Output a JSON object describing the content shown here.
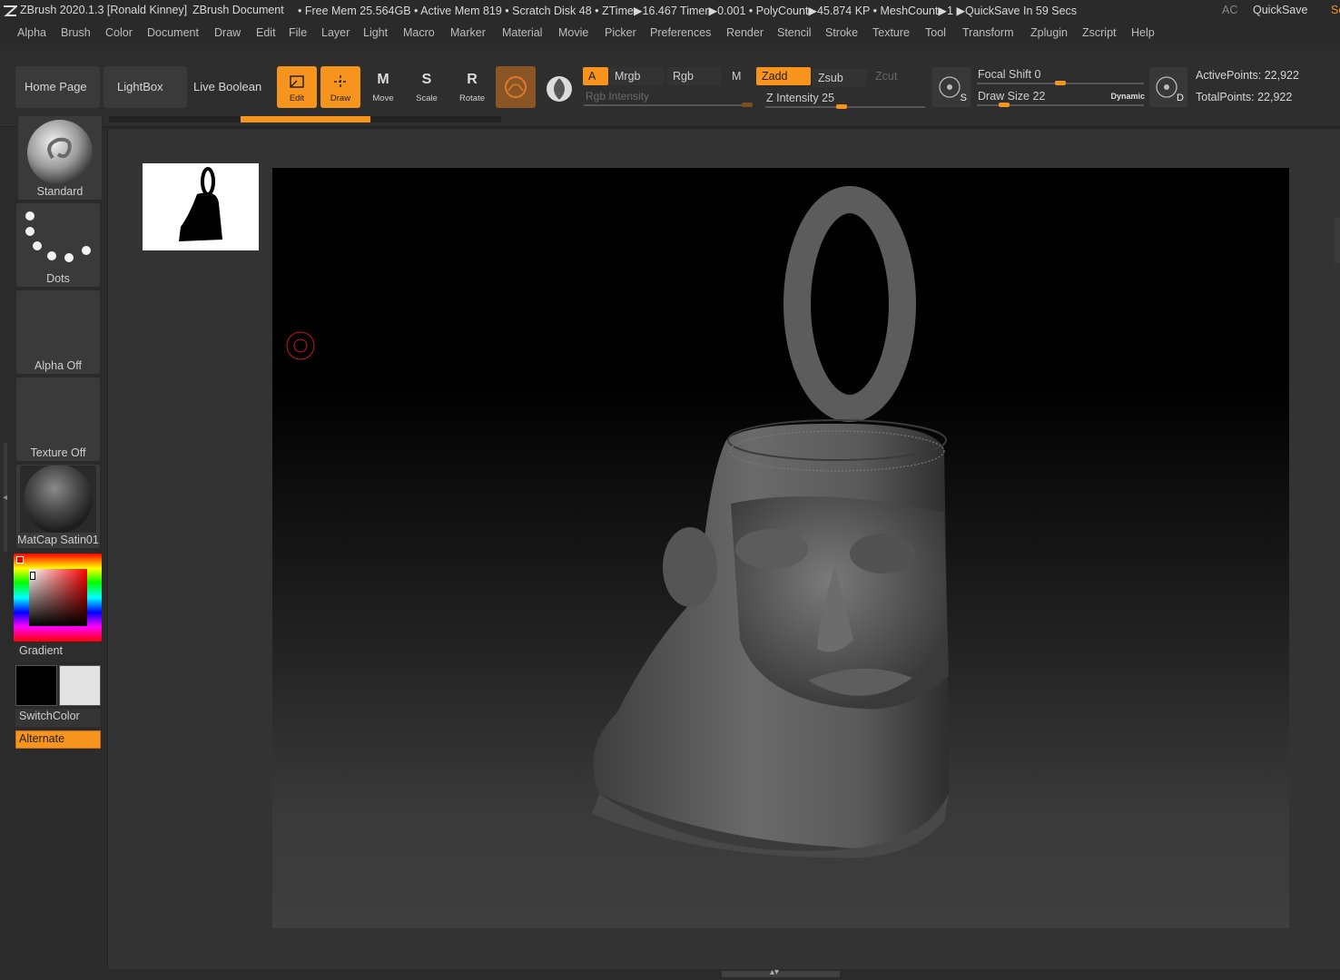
{
  "titlebar": {
    "app": "ZBrush 2020.1.3 [Ronald Kinney]",
    "doc": "ZBrush Document",
    "stats": "• Free Mem 25.564GB • Active Mem 819 • Scratch Disk 48 •  ZTime▶16.467 Timer▶0.001 • PolyCount▶45.874 KP  • MeshCount▶1  ▶QuickSave In 59 Secs",
    "ac": "AC",
    "quicksave": "QuickSave",
    "se": "Se"
  },
  "menus": [
    "Alpha",
    "Brush",
    "Color",
    "Document",
    "Draw",
    "Edit",
    "File",
    "Layer",
    "Light",
    "Macro",
    "Marker",
    "Material",
    "Movie",
    "Picker",
    "Preferences",
    "Render",
    "Stencil",
    "Stroke",
    "Texture",
    "Tool",
    "Transform",
    "Zplugin",
    "Zscript",
    "Help"
  ],
  "shelf": {
    "home": "Home Page",
    "lightbox": "LightBox",
    "liveboolean": "Live Boolean",
    "tools": {
      "edit": "Edit",
      "draw": "Draw",
      "move": "Move",
      "scale": "Scale",
      "rotate": "Rotate"
    },
    "tool_glyphs": {
      "move": "M",
      "scale": "S",
      "rotate": "R"
    },
    "modes": {
      "a": "A",
      "mrgb": "Mrgb",
      "rgb": "Rgb",
      "m": "M",
      "zadd": "Zadd",
      "zsub": "Zsub",
      "zcut": "Zcut"
    },
    "rgb_intensity": "Rgb Intensity",
    "z_intensity_label": "Z Intensity",
    "z_intensity": "25",
    "focal_shift_label": "Focal Shift",
    "focal_shift": "0",
    "draw_size_label": "Draw Size",
    "draw_size": "22",
    "dynamic": "Dynamic",
    "s_label": "S",
    "d_label": "D",
    "active_points": "ActivePoints: 22,922",
    "total_points": "TotalPoints: 22,922"
  },
  "tray": {
    "brush": "Standard",
    "stroke": "Dots",
    "alpha": "Alpha Off",
    "texture": "Texture Off",
    "material": "MatCap Satin01",
    "gradient": "Gradient",
    "switchcolor": "SwitchColor",
    "alternate": "Alternate"
  },
  "colors": {
    "accent": "#f7941d",
    "background": "#2b2b2b",
    "panel": "#3a3a3a"
  },
  "icons": [
    "zbrush-logo-icon",
    "edit-icon",
    "draw-icon",
    "move-icon",
    "scale-icon",
    "rotate-icon",
    "draw-mode-icon",
    "sphere-icon",
    "s-pivot-icon",
    "d-pivot-icon",
    "brush-cursor-icon",
    "bell-silhouette-icon"
  ],
  "scale_values": {
    "z_intensity_fraction": 0.25,
    "focal_shift_fraction": 0.5,
    "draw_size_fraction": 0.11
  }
}
